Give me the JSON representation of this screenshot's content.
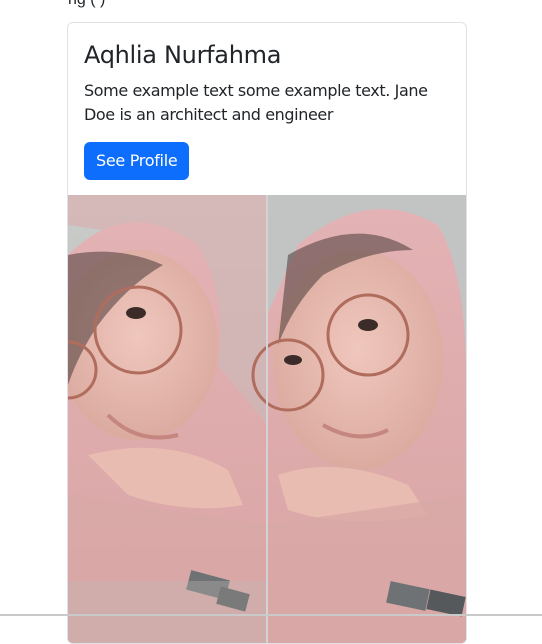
{
  "page": {
    "cut_off_text": "ng   (               )"
  },
  "card": {
    "title": "Aqhlia Nurfahma",
    "text": "Some example text some example text. Jane Doe is an architect and engineer",
    "button_label": "See Profile",
    "image": {
      "description_icon": "photo-image",
      "accent": "#0d6efd"
    }
  }
}
